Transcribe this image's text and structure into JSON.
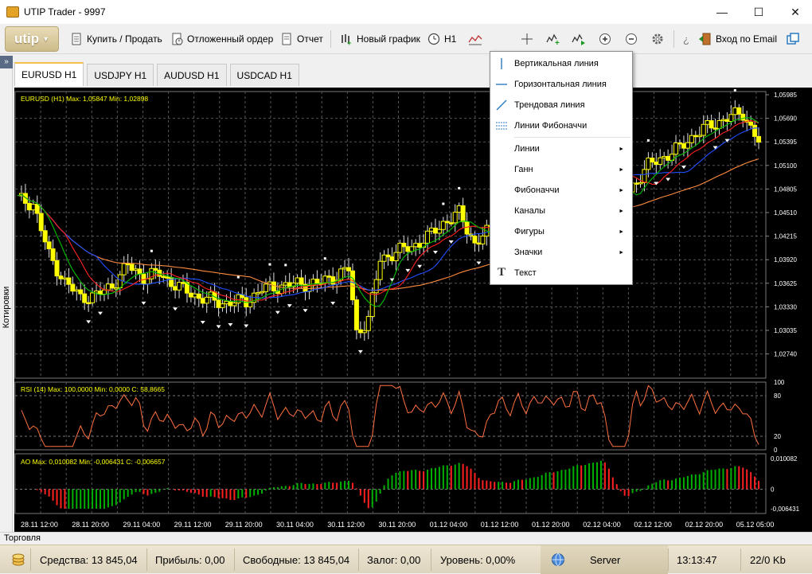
{
  "window": {
    "title": "UTIP Trader - 9997",
    "controls": {
      "minimize": "—",
      "maximize": "☐",
      "close": "✕"
    }
  },
  "toolbar": {
    "logo": "utip",
    "buy_sell": "Купить / Продать",
    "pending_order": "Отложенный ордер",
    "report": "Отчет",
    "new_chart": "Новый график",
    "timeframe": "H1",
    "login_email": "Вход по Email"
  },
  "tabs": [
    {
      "label": "EURUSD  H1",
      "active": true
    },
    {
      "label": "USDJPY  H1",
      "active": false
    },
    {
      "label": "AUDUSD  H1",
      "active": false
    },
    {
      "label": "USDCAD  H1",
      "active": false
    }
  ],
  "side_panel": {
    "label": "Котировки",
    "expand": "»"
  },
  "chart": {
    "main_header": "EURUSD (H1)  Max: 1,05847  Min: 1,02898",
    "price_ticks": [
      "1,05985",
      "1,05690",
      "1,05395",
      "1,05100",
      "1,04805",
      "1,04510",
      "1,04215",
      "1,03920",
      "1,03625",
      "1,03330",
      "1,03035",
      "1,02740"
    ],
    "rsi_header": "RSI (14)  Max: 100,0000  Min: 0,0000  C: 58,8665",
    "rsi_ticks": [
      "100",
      "80",
      "20",
      "0"
    ],
    "ao_header": "AO  Max: 0,010082  Min: -0,006431  C: -0,006657",
    "ao_ticks": [
      "0,010082",
      "0",
      "-0,006431"
    ],
    "time_ticks": [
      "28.11 12:00",
      "28.11 20:00",
      "29.11 04:00",
      "29.11 12:00",
      "29.11 20:00",
      "30.11 04:00",
      "30.11 12:00",
      "30.11 20:00",
      "01.12 04:00",
      "01.12 12:00",
      "01.12 20:00",
      "02.12 04:00",
      "02.12 12:00",
      "02.12 20:00",
      "05.12 05:00"
    ],
    "colors": {
      "candle": "#ffff00",
      "grid": "#555555",
      "ma_fast": "#00c000",
      "ma_mid": "#ff2020",
      "ma_slow": "#2050ff",
      "ma_long": "#ff8c40",
      "rsi": "#ff7040",
      "ao_up": "#00b000",
      "ao_down": "#ff2020",
      "text": "#ffff00"
    }
  },
  "draw_menu": {
    "items": [
      {
        "label": "Вертикальная линия",
        "icon": "vertical-line-icon",
        "submenu": false
      },
      {
        "label": "Горизонтальная линия",
        "icon": "horizontal-line-icon",
        "submenu": false
      },
      {
        "label": "Трендовая линия",
        "icon": "trend-line-icon",
        "submenu": false
      },
      {
        "label": "Линии Фибоначчи",
        "icon": "fibonacci-lines-icon",
        "submenu": false
      },
      {
        "label": "Линии",
        "icon": "",
        "submenu": true
      },
      {
        "label": "Ганн",
        "icon": "",
        "submenu": true
      },
      {
        "label": "Фибоначчи",
        "icon": "",
        "submenu": true
      },
      {
        "label": "Каналы",
        "icon": "",
        "submenu": true
      },
      {
        "label": "Фигуры",
        "icon": "",
        "submenu": true
      },
      {
        "label": "Значки",
        "icon": "",
        "submenu": true
      },
      {
        "label": "Текст",
        "icon": "text-icon",
        "submenu": false
      }
    ],
    "arrow": "►",
    "text_glyph": "T"
  },
  "bottom": {
    "trading_label": "Торговля",
    "equity": "Средства: 13 845,04",
    "profit": "Прибыль: 0,00",
    "free": "Свободные: 13 845,04",
    "margin": "Залог: 0,00",
    "level": "Уровень: 0,00%",
    "server": "Server",
    "time": "13:13:47",
    "traffic": "22/0 Kb"
  }
}
